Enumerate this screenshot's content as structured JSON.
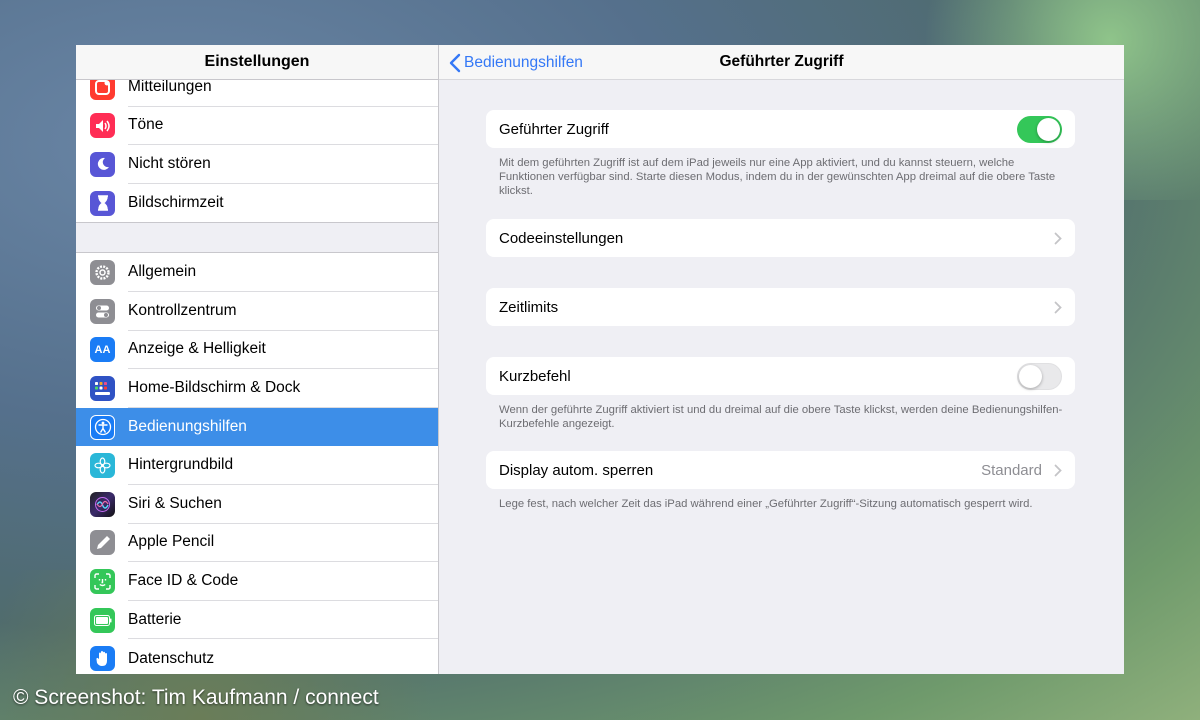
{
  "sidebar": {
    "title": "Einstellungen",
    "group1": [
      {
        "label": "Mitteilungen",
        "icon": "notifications-icon",
        "color": "#ff3b30"
      },
      {
        "label": "Töne",
        "icon": "sounds-icon",
        "color": "#ff2d55"
      },
      {
        "label": "Nicht stören",
        "icon": "moon-icon",
        "color": "#5856d6"
      },
      {
        "label": "Bildschirmzeit",
        "icon": "hourglass-icon",
        "color": "#5856d6"
      }
    ],
    "group2": [
      {
        "label": "Allgemein",
        "icon": "gear-icon",
        "color": "#8e8e93"
      },
      {
        "label": "Kontrollzentrum",
        "icon": "switches-icon",
        "color": "#8e8e93"
      },
      {
        "label": "Anzeige & Helligkeit",
        "icon": "text-size-icon",
        "color": "#1a7cf5"
      },
      {
        "label": "Home-Bildschirm & Dock",
        "icon": "home-grid-icon",
        "color": "#2f52c4"
      },
      {
        "label": "Bedienungshilfen",
        "icon": "accessibility-icon",
        "color": "#1a7cf5",
        "active": true
      },
      {
        "label": "Hintergrundbild",
        "icon": "wallpaper-flower-icon",
        "color": "#2ab7d8"
      },
      {
        "label": "Siri & Suchen",
        "icon": "siri-icon",
        "color": "#222222"
      },
      {
        "label": "Apple Pencil",
        "icon": "pencil-icon",
        "color": "#8e8e93"
      },
      {
        "label": "Face ID & Code",
        "icon": "face-id-icon",
        "color": "#34c759"
      },
      {
        "label": "Batterie",
        "icon": "battery-icon",
        "color": "#34c759"
      },
      {
        "label": "Datenschutz",
        "icon": "hand-icon",
        "color": "#1a7cf5"
      }
    ]
  },
  "detail": {
    "back_label": "Bedienungshilfen",
    "title": "Geführter Zugriff",
    "guided_access": {
      "label": "Geführter Zugriff",
      "enabled": true
    },
    "guided_access_note": "Mit dem geführten Zugriff ist auf dem iPad jeweils nur eine App aktiviert, und du kannst steuern, welche Funktionen verfügbar sind. Starte diesen Modus, indem du in der gewünschten App dreimal auf die obere Taste klickst.",
    "passcode_settings": "Codeeinstellungen",
    "time_limits": "Zeitlimits",
    "shortcut": {
      "label": "Kurzbefehl",
      "enabled": false
    },
    "shortcut_note": "Wenn der geführte Zugriff aktiviert ist und du dreimal auf die obere Taste klickst, werden deine Bedienungshilfen-Kurzbefehle angezeigt.",
    "auto_lock": {
      "label": "Display autom. sperren",
      "value": "Standard"
    },
    "auto_lock_note": "Lege fest, nach welcher Zeit das iPad während einer „Geführter Zugriff“-Sitzung automatisch gesperrt wird."
  },
  "credit": "© Screenshot: Tim Kaufmann / connect"
}
